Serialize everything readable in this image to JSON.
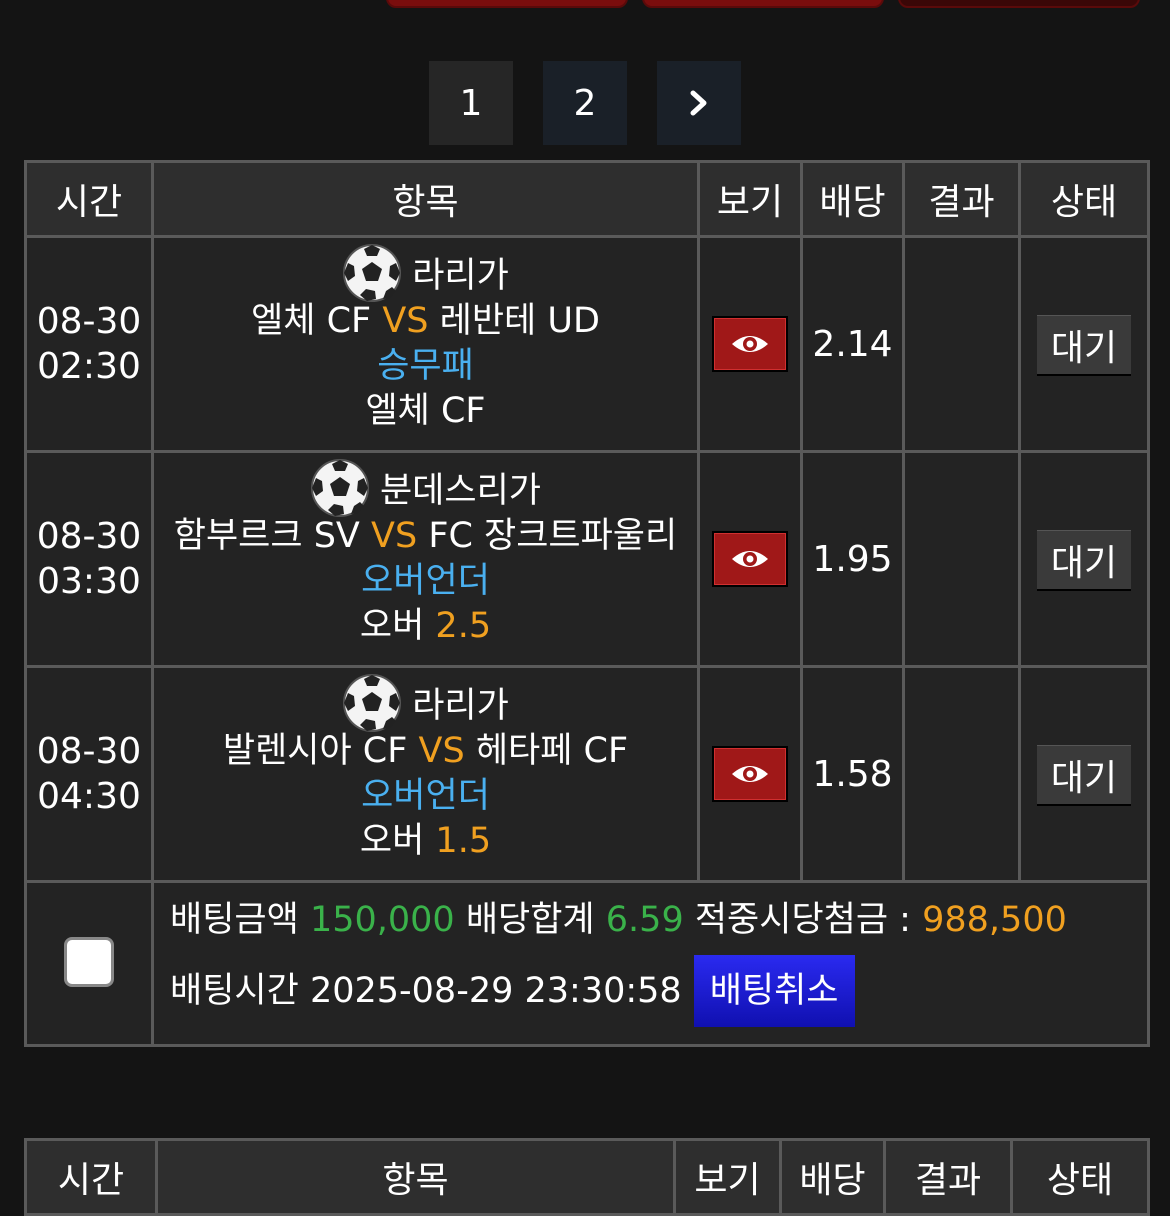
{
  "pagination": {
    "pages": [
      "1",
      "2"
    ],
    "next_icon": "chevron-right-icon"
  },
  "columns": [
    "시간",
    "항목",
    "보기",
    "배당",
    "결과",
    "상태"
  ],
  "bets": [
    {
      "date": "08-30",
      "time": "02:30",
      "league": "라리가",
      "home": "엘체 CF",
      "vs": "VS",
      "away": "레반테 UD",
      "market": "승무패",
      "pick_text": "엘체 CF",
      "pick_value": "",
      "odds": "2.14",
      "result": "",
      "status": "대기"
    },
    {
      "date": "08-30",
      "time": "03:30",
      "league": "분데스리가",
      "home": "함부르크 SV",
      "vs": "VS",
      "away": "FC 장크트파울리",
      "market": "오버언더",
      "pick_text": "오버 ",
      "pick_value": "2.5",
      "odds": "1.95",
      "result": "",
      "status": "대기"
    },
    {
      "date": "08-30",
      "time": "04:30",
      "league": "라리가",
      "home": "발렌시아 CF",
      "vs": "VS",
      "away": "헤타페 CF",
      "market": "오버언더",
      "pick_text": "오버 ",
      "pick_value": "1.5",
      "odds": "1.58",
      "result": "",
      "status": "대기"
    }
  ],
  "summary": {
    "bet_amount_label": "배팅금액",
    "bet_amount": "150,000",
    "odds_total_label": "배당합계",
    "odds_total": "6.59",
    "payout_label": "적중시당첨금 :",
    "payout": "988,500",
    "bet_time_label": "배팅시간",
    "bet_time": "2025-08-29 23:30:58",
    "cancel_label": "배팅취소"
  },
  "colors": {
    "vs": "#f0a020",
    "market": "#4ab0f0",
    "odds": "#3ab24a",
    "cancel": "#2a2af0",
    "eye_button": "#a01818"
  }
}
